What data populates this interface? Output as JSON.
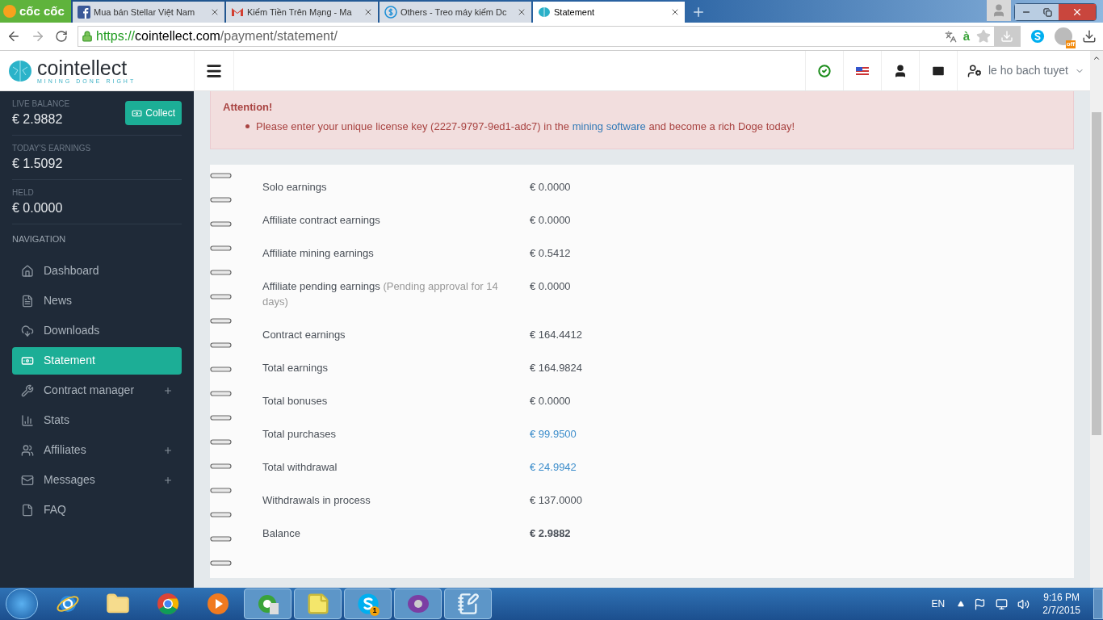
{
  "browser": {
    "brand": "cốc cốc",
    "tabs": [
      {
        "title": "Mua bán Stellar Việt Nam",
        "selected": false
      },
      {
        "title": "Kiếm Tiền Trên Mạng - Ma",
        "selected": false
      },
      {
        "title": "Others - Treo máy kiếm Dc",
        "selected": false
      },
      {
        "title": "Statement",
        "selected": true
      }
    ],
    "url": {
      "scheme": "https://",
      "host": "cointellect.com",
      "path": "/payment/statement/"
    },
    "input_method": "à",
    "extension_badge": "off"
  },
  "site": {
    "logo": "cointellect",
    "tagline": "MINING DONE RIGHT",
    "username": "le ho bach tuyet"
  },
  "sidebar": {
    "stats": [
      {
        "label": "LIVE BALANCE",
        "value": "€ 2.9882"
      },
      {
        "label": "TODAY'S EARNINGS",
        "value": "€ 1.5092"
      },
      {
        "label": "HELD",
        "value": "€ 0.0000"
      }
    ],
    "collect_button": "Collect",
    "nav_heading": "NAVIGATION",
    "items": [
      {
        "label": "Dashboard",
        "selected": false,
        "expandable": false
      },
      {
        "label": "News",
        "selected": false,
        "expandable": false
      },
      {
        "label": "Downloads",
        "selected": false,
        "expandable": false
      },
      {
        "label": "Statement",
        "selected": true,
        "expandable": false
      },
      {
        "label": "Contract manager",
        "selected": false,
        "expandable": true
      },
      {
        "label": "Stats",
        "selected": false,
        "expandable": false
      },
      {
        "label": "Affiliates",
        "selected": false,
        "expandable": true
      },
      {
        "label": "Messages",
        "selected": false,
        "expandable": true
      },
      {
        "label": "FAQ",
        "selected": false,
        "expandable": false
      }
    ]
  },
  "alert": {
    "title": "Attention!",
    "before": "Please enter your unique license key (2227-9797-9ed1-adc7) in the",
    "link": "mining software",
    "after": "and become a rich Doge today!"
  },
  "statement": [
    {
      "label": "Solo earnings",
      "value": "€ 0.0000",
      "kind": "plain"
    },
    {
      "label": "Affiliate contract earnings",
      "value": "€ 0.0000",
      "kind": "plain"
    },
    {
      "label": "Affiliate mining earnings",
      "value": "€ 0.5412",
      "kind": "plain"
    },
    {
      "label": "Affiliate pending earnings",
      "note": "(Pending approval for 14 days)",
      "value": "€ 0.0000",
      "kind": "plain"
    },
    {
      "label": "Contract earnings",
      "value": "€ 164.4412",
      "kind": "plain"
    },
    {
      "label": "Total earnings",
      "value": "€ 164.9824",
      "kind": "plain"
    },
    {
      "label": "Total bonuses",
      "value": "€ 0.0000",
      "kind": "plain"
    },
    {
      "label": "Total purchases",
      "value": "€ 99.9500",
      "kind": "link"
    },
    {
      "label": "Total withdrawal",
      "value": "€ 24.9942",
      "kind": "link"
    },
    {
      "label": "Withdrawals in process",
      "value": "€ 137.0000",
      "kind": "plain"
    },
    {
      "label": "Balance",
      "value": "€ 2.9882",
      "kind": "total"
    }
  ],
  "taskbar": {
    "apps": [
      {
        "running": false
      },
      {
        "running": false
      },
      {
        "running": false
      },
      {
        "running": false
      },
      {
        "running": true
      },
      {
        "running": true
      },
      {
        "running": true,
        "badge": "1"
      },
      {
        "running": true
      },
      {
        "running": true
      }
    ],
    "language": "EN",
    "time": "9:16 PM",
    "date": "2/7/2015"
  }
}
